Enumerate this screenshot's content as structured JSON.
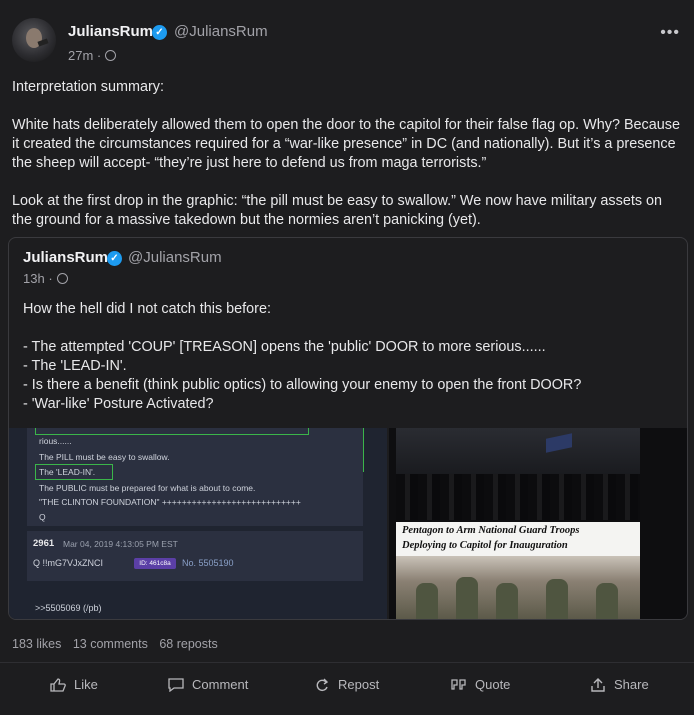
{
  "post": {
    "author_name": "JuliansRum",
    "author_handle": "@JuliansRum",
    "time": "27m",
    "paragraphs": [
      "Interpretation summary:",
      "White hats deliberately allowed them to open the door to the capitol for their false flag op. Why? Because it created the circumstances required for a “war-like presence” in DC (and nationally). But it’s a presence the sheep will accept- “they’re just here to defend us from maga terrorists.”",
      "Look at the first drop in the graphic: “the pill must be easy to swallow.” We now have military assets on the ground for a massive takedown but the normies aren’t panicking (yet)."
    ]
  },
  "quote": {
    "author_name": "JuliansRum",
    "author_handle": "@JuliansRum",
    "time": "13h",
    "lines": [
      "How the hell did I not catch this before:",
      "- The attempted 'COUP' [TREASON] opens the 'public' DOOR to more serious......",
      "- The 'LEAD-IN'.",
      "- Is there a benefit (think public optics) to allowing your enemy to open the front DOOR?",
      "- 'War-like' Posture Activated?"
    ],
    "image": {
      "drop_lines": [
        "rious......",
        "The PILL must be easy to swallow.",
        "The 'LEAD-IN'.",
        "The PUBLIC must be prepared for what is about to come.",
        "\"THE CLINTON FOUNDATION\" ++++++++++++++++++++++++++++",
        "Q"
      ],
      "post_number": "2961",
      "post_date": "Mar 04, 2019 4:13:05 PM EST",
      "tripcode": "Q  !!mG7VJxZNCI",
      "id_badge": "ID: 461c8a",
      "post_no": "No. 5505190",
      "reply_ref": ">>5505069 (/pb)",
      "headline_1": "Pentagon to Arm National Guard Troops",
      "headline_2": "Deploying to Capitol for Inauguration"
    }
  },
  "stats": {
    "likes": "183 likes",
    "comments": "13 comments",
    "reposts": "68 reposts"
  },
  "actions": {
    "like": "Like",
    "comment": "Comment",
    "repost": "Repost",
    "quote": "Quote",
    "share": "Share"
  },
  "more_icon": "ellipsis-icon",
  "verified_icon": "verified-badge-icon",
  "accent_color": "#1d9bf0"
}
